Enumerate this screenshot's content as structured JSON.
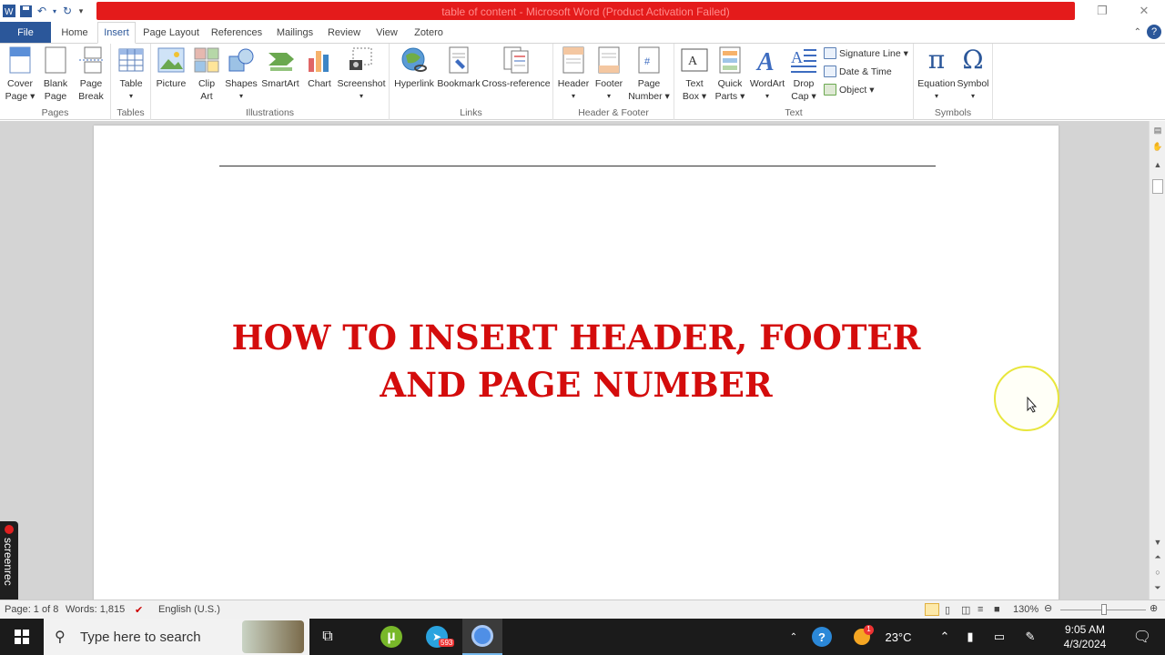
{
  "window": {
    "title": "table of content - Microsoft Word (Product Activation Failed)"
  },
  "tabs": [
    "File",
    "Home",
    "Insert",
    "Page Layout",
    "References",
    "Mailings",
    "Review",
    "View",
    "Zotero"
  ],
  "ribbon": {
    "pages": {
      "label": "Pages",
      "cover": [
        "Cover",
        "Page ▾"
      ],
      "blank": [
        "Blank",
        "Page"
      ],
      "break": [
        "Page",
        "Break"
      ]
    },
    "tables": {
      "label": "Tables",
      "table": [
        "Table",
        "▾"
      ]
    },
    "illustrations": {
      "label": "Illustrations",
      "picture": "Picture",
      "clipart": [
        "Clip",
        "Art"
      ],
      "shapes": [
        "Shapes",
        "▾"
      ],
      "smartart": "SmartArt",
      "chart": "Chart",
      "screenshot": [
        "Screenshot",
        "▾"
      ]
    },
    "links": {
      "label": "Links",
      "hyperlink": "Hyperlink",
      "bookmark": "Bookmark",
      "crossref": "Cross-reference"
    },
    "headerfooter": {
      "label": "Header & Footer",
      "header": [
        "Header",
        "▾"
      ],
      "footer": [
        "Footer",
        "▾"
      ],
      "pagenumber": [
        "Page",
        "Number ▾"
      ]
    },
    "text": {
      "label": "Text",
      "textbox": [
        "Text",
        "Box ▾"
      ],
      "quickparts": [
        "Quick",
        "Parts ▾"
      ],
      "wordart": [
        "WordArt",
        "▾"
      ],
      "dropcap": [
        "Drop",
        "Cap ▾"
      ],
      "signature": "Signature Line ▾",
      "datetime": "Date & Time",
      "object": "Object ▾"
    },
    "symbols": {
      "label": "Symbols",
      "equation": [
        "Equation",
        "▾"
      ],
      "symbol": [
        "Symbol",
        "▾"
      ]
    }
  },
  "document": {
    "title_line1": "HOW TO INSERT HEADER, FOOTER",
    "title_line2": "AND PAGE NUMBER"
  },
  "status": {
    "page": "Page: 1 of 8",
    "words": "Words: 1,815",
    "language": "English (U.S.)",
    "zoom": "130%"
  },
  "overlay": {
    "screenrec": "screenrec"
  },
  "taskbar": {
    "search_placeholder": "Type here to search",
    "telegram_badge": "593",
    "weather": "23°C",
    "weather_badge": "1",
    "time": "9:05 AM",
    "date": "4/3/2024"
  },
  "colors": {
    "accent": "#2b579a",
    "title_red": "#d40c0c",
    "titlebar_red": "#e41b1b"
  }
}
